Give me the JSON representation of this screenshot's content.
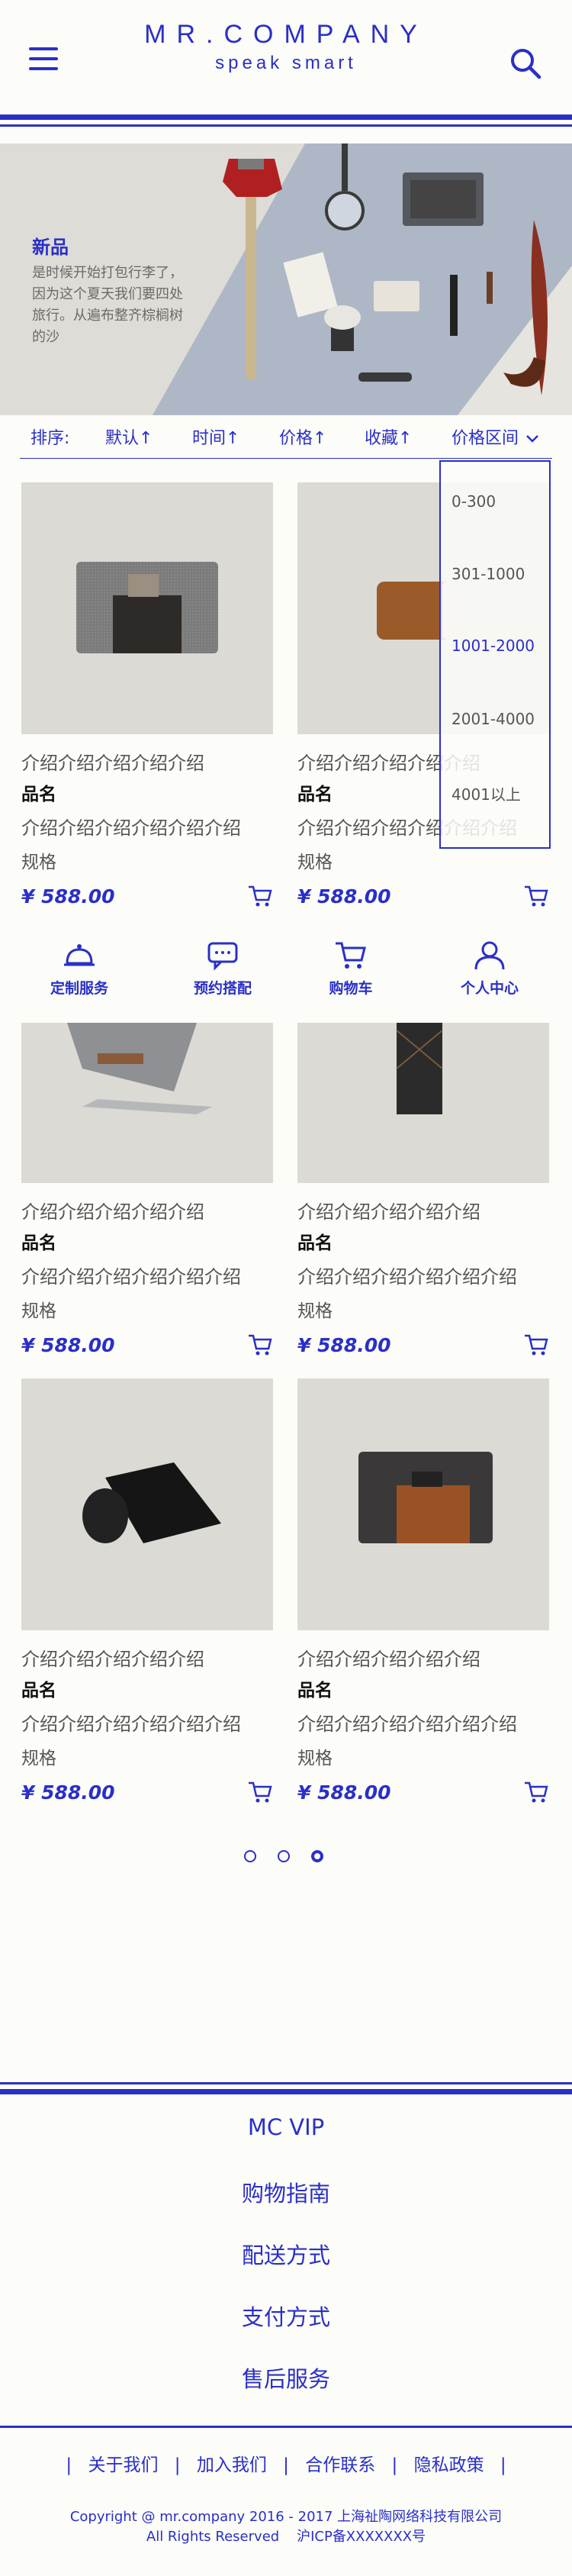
{
  "header": {
    "logo_main": "MR.COMPANY",
    "logo_sub": "speak smart",
    "menu_icon": "hamburger-icon",
    "search_icon": "search-icon"
  },
  "banner": {
    "title": "新品",
    "text": "是时候开始打包行李了，因为这个夏天我们要四处旅行。从遍布整齐棕榈树的沙"
  },
  "sortbar": {
    "label": "排序:",
    "options": [
      "默认↑",
      "时间↑",
      "价格↑",
      "收藏↑",
      "价格区间"
    ]
  },
  "price_dropdown": {
    "options": [
      "0-300",
      "301-1000",
      "1001-2000",
      "2001-4000",
      "4001以上"
    ],
    "selected": "1001-2000"
  },
  "products": [
    {
      "line1": "介绍介绍介绍介绍介绍",
      "name": "品名",
      "line2": "介绍介绍介绍介绍介绍介绍",
      "spec": "规格",
      "price": "¥ 588.00"
    },
    {
      "line1": "介绍介绍介绍介绍介绍",
      "name": "品名",
      "line2": "介绍介绍介绍介绍介绍介绍",
      "spec": "规格",
      "price": "¥ 588.00"
    },
    {
      "line1": "介绍介绍介绍介绍介绍",
      "name": "品名",
      "line2": "介绍介绍介绍介绍介绍介绍",
      "spec": "规格",
      "price": "¥ 588.00"
    },
    {
      "line1": "介绍介绍介绍介绍介绍",
      "name": "品名",
      "line2": "介绍介绍介绍介绍介绍介绍",
      "spec": "规格",
      "price": "¥ 588.00"
    },
    {
      "line1": "介绍介绍介绍介绍介绍",
      "name": "品名",
      "line2": "介绍介绍介绍介绍介绍介绍",
      "spec": "规格",
      "price": "¥ 588.00"
    },
    {
      "line1": "介绍介绍介绍介绍介绍",
      "name": "品名",
      "line2": "介绍介绍介绍介绍介绍介绍",
      "spec": "规格",
      "price": "¥ 588.00"
    }
  ],
  "quicknav": [
    {
      "label": "定制服务",
      "icon": "service-bell-icon"
    },
    {
      "label": "预约搭配",
      "icon": "chat-bubble-icon"
    },
    {
      "label": "购物车",
      "icon": "shopping-cart-icon"
    },
    {
      "label": "个人中心",
      "icon": "user-icon"
    }
  ],
  "pagination": {
    "pages": 3,
    "current": 3
  },
  "footer": {
    "links": [
      "MC VIP",
      "购物指南",
      "配送方式",
      "支付方式",
      "售后服务"
    ],
    "bottom_links": [
      "关于我们",
      "加入我们",
      "合作联系",
      "隐私政策"
    ],
    "copyright": "Copyright @ mr.company 2016 - 2017 上海祉陶网络科技有限公司",
    "rights": "All Rights Reserved    沪ICP备XXXXXXX号"
  },
  "colors": {
    "accent": "#2a2fc8",
    "background": "#fcfcf8",
    "image_bg": "#dcdad5"
  }
}
